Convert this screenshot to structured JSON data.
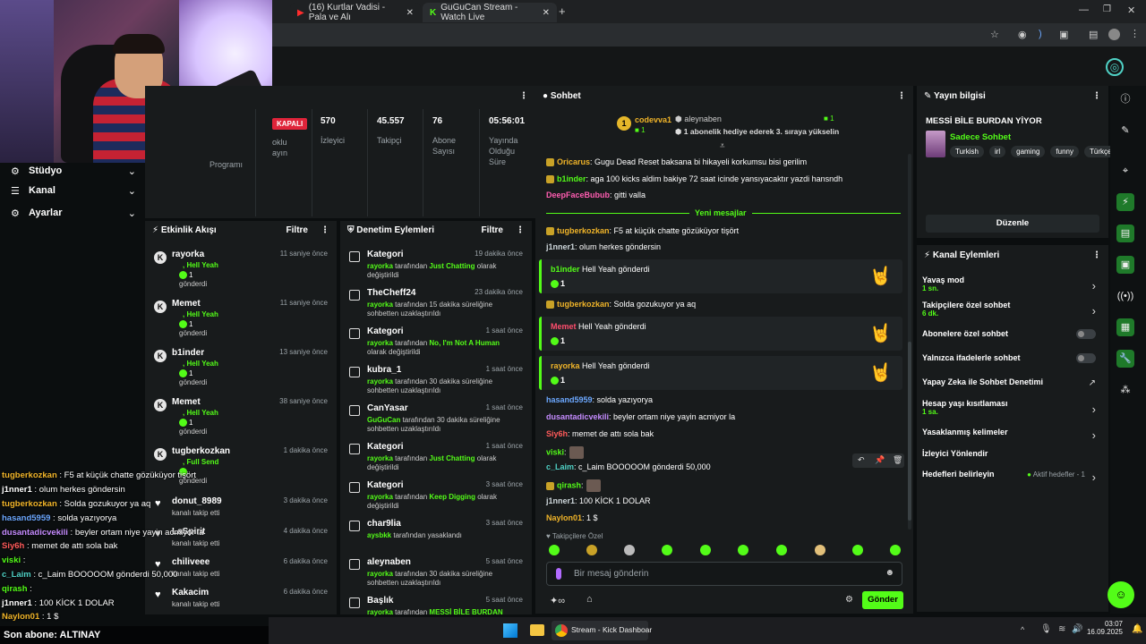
{
  "browser": {
    "tabs": [
      {
        "label": "(16) Kurtlar Vadisi - Pala ve Alı"
      },
      {
        "label": "GuGuCan Stream - Watch Live"
      }
    ],
    "new_tab": "+"
  },
  "left_nav": {
    "items": [
      {
        "label": "Stüdyo"
      },
      {
        "label": "Kanal"
      },
      {
        "label": "Ayarlar"
      }
    ]
  },
  "stats": {
    "status_badge": "KAPALI",
    "status_label_1": "oklu",
    "status_label_2": "ayın",
    "program_label": "Programı",
    "items": [
      {
        "value": "570",
        "label": "İzleyici"
      },
      {
        "value": "45.557",
        "label": "Takipçi"
      },
      {
        "value": "76",
        "label": "Abone Sayısı"
      },
      {
        "value": "05:56:01",
        "label": "Yayında Olduğu Süre"
      }
    ]
  },
  "activity": {
    "title": "Etkinlik Akışı",
    "filter": "Filtre",
    "events": [
      {
        "name": "rayorka",
        "time": "11 saniye önce",
        "sub": ", Hell Yeah",
        "count": "1",
        "gave": "gönderdi",
        "icon": "K"
      },
      {
        "name": "Memet",
        "time": "11 saniye önce",
        "sub": ", Hell Yeah",
        "count": "1",
        "gave": "gönderdi",
        "icon": "K"
      },
      {
        "name": "b1inder",
        "time": "13 saniye önce",
        "sub": ", Hell Yeah",
        "count": "1",
        "gave": "gönderdi",
        "icon": "K"
      },
      {
        "name": "Memet",
        "time": "38 saniye önce",
        "sub": ", Hell Yeah",
        "count": "1",
        "gave": "gönderdi",
        "icon": "K"
      },
      {
        "name": "tugberkozkan",
        "time": "1 dakika önce",
        "sub": ", Full Send",
        "count": "",
        "gave": "gönderdi",
        "icon": "K"
      }
    ],
    "follows": [
      {
        "name": "donut_8989",
        "time": "3 dakika önce",
        "desc": "kanalı takip etti"
      },
      {
        "name": "LaSpirit",
        "time": "4 dakika önce",
        "desc": "kanalı takip etti"
      },
      {
        "name": "chiliveee",
        "time": "6 dakika önce",
        "desc": "kanalı takip etti"
      },
      {
        "name": "Kakacim",
        "time": "6 dakika önce",
        "desc": "kanalı takip etti"
      }
    ]
  },
  "moderation": {
    "title": "Denetim Eylemleri",
    "filter": "Filtre",
    "items": [
      {
        "name": "Kategori",
        "time": "19 dakika önce",
        "user": "rayorka",
        "mid": " tarafından ",
        "hl": "Just Chatting",
        "tail": " olarak değiştirildi"
      },
      {
        "name": "TheCheff24",
        "time": "23 dakika önce",
        "user": "rayorka",
        "mid": " tarafından 15 dakika süreliğine sohbetten uzaklaştırıldı",
        "hl": "",
        "tail": ""
      },
      {
        "name": "Kategori",
        "time": "1 saat önce",
        "user": "rayorka",
        "mid": " tarafından ",
        "hl": "No, I'm Not A Human",
        "tail": " olarak değiştirildi"
      },
      {
        "name": "kubra_1",
        "time": "1 saat önce",
        "user": "rayorka",
        "mid": " tarafından 30 dakika süreliğine sohbetten uzaklaştırıldı",
        "hl": "",
        "tail": ""
      },
      {
        "name": "CanYasar",
        "time": "1 saat önce",
        "user": "GuGuCan",
        "mid": " tarafından 30 dakika süreliğine sohbetten uzaklaştırıldı",
        "hl": "",
        "tail": ""
      },
      {
        "name": "Kategori",
        "time": "1 saat önce",
        "user": "rayorka",
        "mid": " tarafından ",
        "hl": "Just Chatting",
        "tail": " olarak değiştirildi"
      },
      {
        "name": "Kategori",
        "time": "3 saat önce",
        "user": "rayorka",
        "mid": " tarafından ",
        "hl": "Keep Digging",
        "tail": " olarak değiştirildi"
      },
      {
        "name": "char9lia",
        "time": "3 saat önce",
        "user": "aysbkk",
        "mid": " tarafından yasaklandı",
        "hl": "",
        "tail": ""
      },
      {
        "name": "aleynaben",
        "time": "5 saat önce",
        "user": "rayorka",
        "mid": " tarafından 30 dakika süreliğine sohbetten uzaklaştırıldı",
        "hl": "",
        "tail": ""
      },
      {
        "name": "Başlık",
        "time": "5 saat önce",
        "user": "rayorka",
        "mid": " tarafından ",
        "hl": "MESSİ BİLE BURDAN YİYOR",
        "tail": " olarak değiştirildi"
      }
    ]
  },
  "chat": {
    "title": "Sohbet",
    "top_gifters": [
      {
        "name": "codevva1",
        "count": "1"
      },
      {
        "name": "aleynaben",
        "count": "1"
      }
    ],
    "pinned": "1 abonelik hediye ederek 3. sıraya yükselin",
    "rank": "1",
    "new_messages": "Yeni mesajlar",
    "messages": [
      {
        "user": "Oricarus",
        "color": "#f0b429",
        "text": ": Gugu Dead Reset baksana bi hikayeli korkumsu bisi gerilim"
      },
      {
        "user": "b1inder",
        "color": "#53fc18",
        "text": ": aga 100 kicks aldim bakiye 72 saat icinde yansıyacaktır yazdi hansndh"
      },
      {
        "user": "DeepFaceBubub",
        "color": "#ff5db1",
        "text": ": gitti valla"
      },
      {
        "user": "tugberkozkan",
        "color": "#f0b429",
        "text": ": F5 at küçük chatte gözüküyor tişört"
      },
      {
        "user": "j1nner1",
        "color": "#cfd8dc",
        "text": ": olum herkes göndersin"
      },
      {
        "user": "tugberkozkan",
        "color": "#f0b429",
        "text": ": Solda gozukuyor ya aq"
      },
      {
        "user": "hasand5959",
        "color": "#6ca8ff",
        "text": ": solda yazıyorya"
      },
      {
        "user": "dusantadicvekili",
        "color": "#c58cff",
        "text": ": beyler ortam niye yayin acmiyor la"
      },
      {
        "user": "Siy6h",
        "color": "#ff5a5a",
        "text": ": memet de attı sola bak"
      },
      {
        "user": "viski",
        "color": "#53fc18",
        "text": ":"
      },
      {
        "user": "c_Laim",
        "color": "#4fd1c5",
        "text": ": c_Laim BOOOOOM gönderdi 50,000"
      },
      {
        "user": "qirash",
        "color": "#53fc18",
        "text": ":"
      },
      {
        "user": "j1nner1",
        "color": "#cfd8dc",
        "text": ": 100 KİCK 1 DOLAR"
      },
      {
        "user": "Naylon01",
        "color": "#f0b429",
        "text": ": 1 $"
      }
    ],
    "gifts": [
      {
        "user": "b1inder",
        "color": "#53fc18",
        "text": " Hell Yeah gönderdi",
        "count": "1"
      },
      {
        "user": "Memet",
        "color": "#ff4d6d",
        "text": " Hell Yeah gönderdi",
        "count": "1"
      },
      {
        "user": "rayorka",
        "color": "#f0b429",
        "text": " Hell Yeah gönderdi",
        "count": "1"
      }
    ],
    "followers_only": "Takipçilere Özel",
    "input_placeholder": "Bir mesaj gönderin",
    "send": "Gönder"
  },
  "stream_info": {
    "title": "Yayın bilgisi",
    "stream_title": "MESSİ BİLE BURDAN YİYOR",
    "category": "Sadece Sohbet",
    "tags": [
      "Turkish",
      "irl",
      "gaming",
      "funny",
      "Türkçe"
    ],
    "edit": "Düzenle"
  },
  "channel_actions": {
    "title": "Kanal Eylemleri",
    "items": [
      {
        "label": "Yavaş mod",
        "sub": "1 sn.",
        "control": "arrow"
      },
      {
        "label": "Takipçilere özel sohbet",
        "sub": "6 dk.",
        "control": "arrow"
      },
      {
        "label": "Abonelere özel sohbet",
        "sub": "",
        "control": "toggle"
      },
      {
        "label": "Yalnızca ifadelerle sohbet",
        "sub": "",
        "control": "toggle"
      },
      {
        "label": "Yapay Zeka ile Sohbet Denetimi",
        "sub": "",
        "control": "external"
      },
      {
        "label": "Hesap yaşı kısıtlaması",
        "sub": "1 sa.",
        "control": "arrow"
      },
      {
        "label": "Yasaklanmış kelimeler",
        "sub": "",
        "control": "arrow"
      },
      {
        "label": "İzleyici Yönlendir",
        "sub": "",
        "control": ""
      },
      {
        "label": "Hedefleri belirleyin",
        "sub": "",
        "control": "arrow",
        "extra": "Aktif hedefler - 1"
      }
    ]
  },
  "overlay_chat": [
    {
      "user": "tugberkozkan",
      "color": "#f0b429",
      "text": " : F5 at küçük chatte gözüküyor tişört"
    },
    {
      "user": "j1nner1",
      "color": "#ffffff",
      "text": " : olum herkes göndersin"
    },
    {
      "user": "tugberkozkan",
      "color": "#f0b429",
      "text": " : Solda gozukuyor ya aq"
    },
    {
      "user": "hasand5959",
      "color": "#6ca8ff",
      "text": " : solda yazıyorya"
    },
    {
      "user": "dusantadicvekili",
      "color": "#c58cff",
      "text": " : beyler ortam niye yayin acmiyor la"
    },
    {
      "user": "Siy6h",
      "color": "#ff5a5a",
      "text": " : memet de attı sola bak"
    },
    {
      "user": "viski",
      "color": "#53fc18",
      "text": " :"
    },
    {
      "user": "c_Laim",
      "color": "#4fd1c5",
      "text": " : c_Laim BOOOOOM gönderdi 50,000"
    },
    {
      "user": "qirash",
      "color": "#53fc18",
      "text": " :"
    },
    {
      "user": "j1nner1",
      "color": "#ffffff",
      "text": " : 100 KİCK 1 DOLAR"
    },
    {
      "user": "Naylon01",
      "color": "#f0b429",
      "text": " : 1 $"
    }
  ],
  "last_sub": "Son abone: ALTINAY",
  "taskbar": {
    "app_label": "Stream - Kick Dashboar",
    "time": "03:07",
    "date": "16.09.2025"
  },
  "colors": {
    "accent": "#53fc18",
    "panel": "#181b1c",
    "bg": "#0b0e0f"
  }
}
